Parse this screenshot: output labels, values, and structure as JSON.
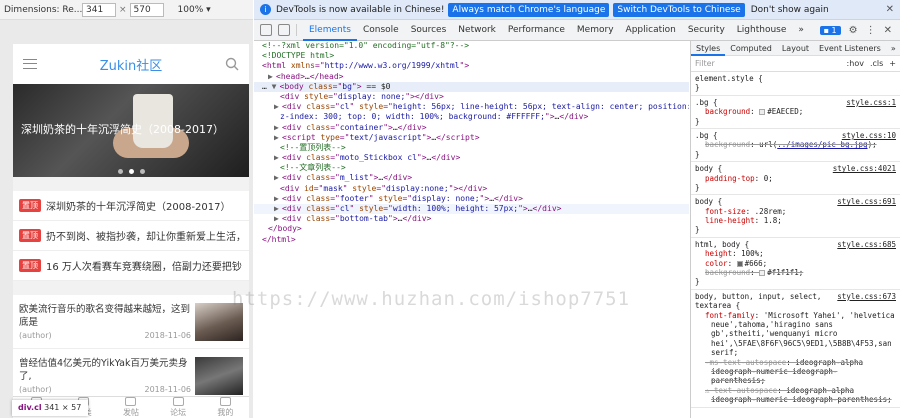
{
  "device_toolbar": {
    "dimensions_label": "Dimensions: Re...",
    "width": "341",
    "height": "570",
    "zoom": "100%"
  },
  "mobile_page": {
    "site_title": "Zukin社区",
    "banner_caption": "深圳奶茶的十年沉浮简史（2008-2017）",
    "sticky_badge": "置顶",
    "sticky_items": [
      "深圳奶茶的十年沉浮简史（2008-2017）",
      "扔不到岗、被指抄袭，却让你重新爱上生活，",
      "16 万人次看赛车竞赛绕圈，倍副力还要把钞"
    ],
    "articles": [
      {
        "title": "欧美流行音乐的歌名变得越来越短，这到底是",
        "author": "(author)",
        "date": "2018-11-06"
      },
      {
        "title": "曾经估值4亿美元的YikYak百万美元卖身了,",
        "author": "(author)",
        "date": "2018-11-06"
      }
    ],
    "tabs": [
      "首页",
      "分类",
      "发帖",
      "论坛",
      "我的"
    ]
  },
  "element_tooltip": {
    "name": "div.cl",
    "size": "341 × 57"
  },
  "devtools": {
    "info_text": "DevTools is now available in Chinese!",
    "info_btn_1": "Always match Chrome's language",
    "info_btn_2": "Switch DevTools to Chinese",
    "info_dismiss": "Don't show again",
    "tabs": [
      "Elements",
      "Console",
      "Sources",
      "Network",
      "Performance",
      "Memory",
      "Application",
      "Security",
      "Lighthouse"
    ],
    "more_tabs": "»",
    "msg_count": "1"
  },
  "styles_pane": {
    "tabs": [
      "Styles",
      "Computed",
      "Layout",
      "Event Listeners"
    ],
    "more": "»",
    "filter_placeholder": "Filter",
    "hov": ":hov",
    "cls": ".cls",
    "element_style": "element.style {",
    "close": "}"
  },
  "watermark": "https://www.huzhan.com/ishop7751",
  "colors": {
    "accent": "#1a73e8",
    "badge": "#e64340",
    "title": "#3a8ee6"
  }
}
